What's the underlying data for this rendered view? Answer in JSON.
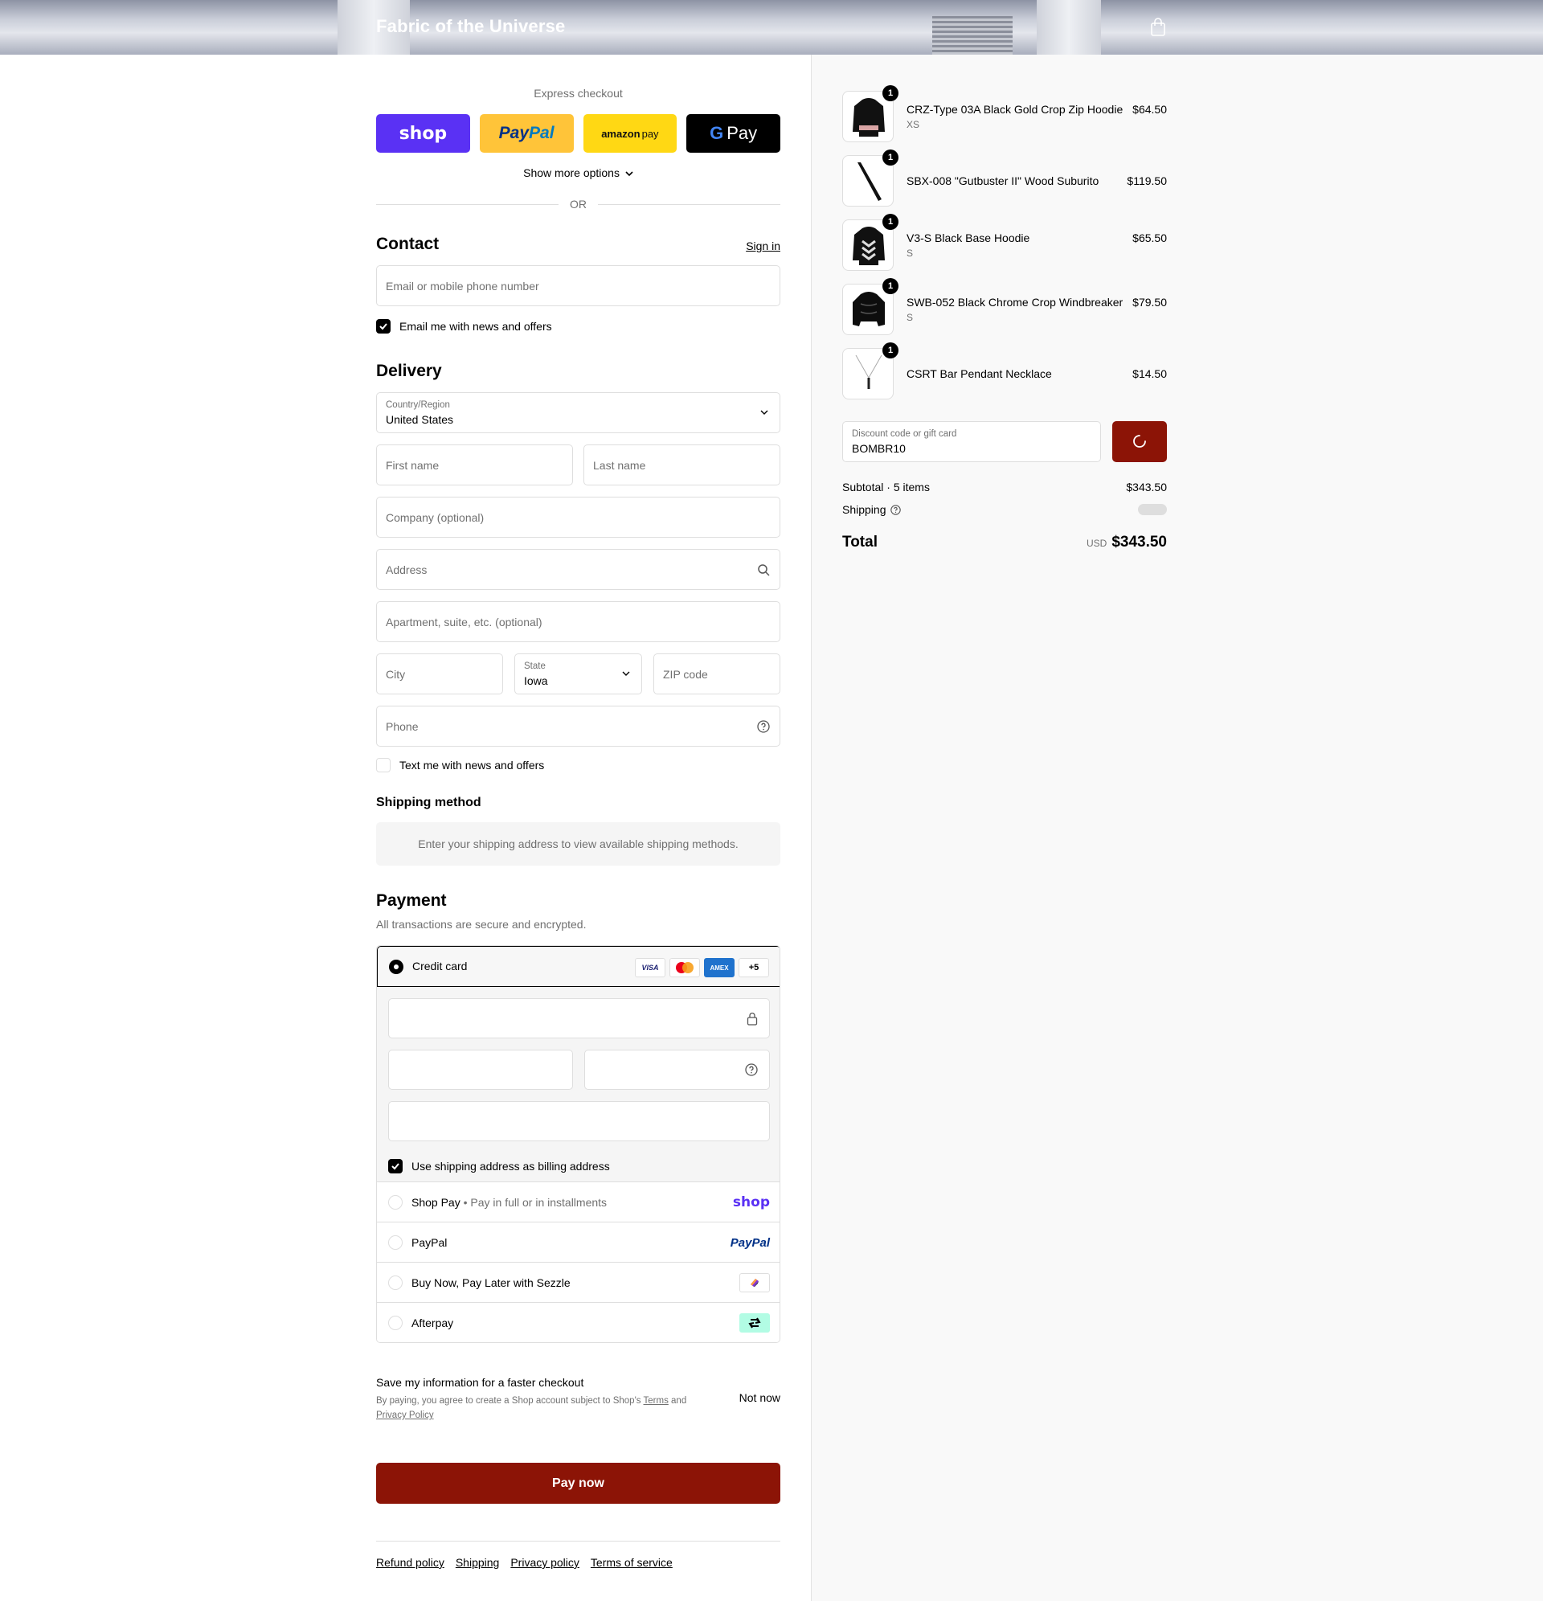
{
  "header": {
    "store_name": "Fabric of the Universe",
    "cart_icon": "shopping-bag-icon"
  },
  "express": {
    "title": "Express checkout",
    "buttons": [
      {
        "name": "shop",
        "label": "shop"
      },
      {
        "name": "paypal",
        "label_a": "Pay",
        "label_b": "Pal"
      },
      {
        "name": "amazon",
        "label_a": "amazon",
        "label_b": "pay"
      },
      {
        "name": "gpay",
        "label_a": "G",
        "label_b": "Pay"
      }
    ],
    "show_more": "Show more options",
    "or": "OR"
  },
  "contact": {
    "title": "Contact",
    "sign_in": "Sign in",
    "email_placeholder": "Email or mobile phone number",
    "newsletter_label": "Email me with news and offers",
    "newsletter_checked": true
  },
  "delivery": {
    "title": "Delivery",
    "country_label": "Country/Region",
    "country_value": "United States",
    "first_name": "First name",
    "last_name": "Last name",
    "company": "Company (optional)",
    "address": "Address",
    "apartment": "Apartment, suite, etc. (optional)",
    "city": "City",
    "state_label": "State",
    "state_value": "Iowa",
    "zip": "ZIP code",
    "phone": "Phone",
    "text_offers_label": "Text me with news and offers",
    "text_offers_checked": false
  },
  "shipping_method": {
    "title": "Shipping method",
    "message": "Enter your shipping address to view available shipping methods."
  },
  "payment": {
    "title": "Payment",
    "subtitle": "All transactions are secure and encrypted.",
    "credit_card_label": "Credit card",
    "card_brands": [
      "VISA",
      "mastercard",
      "AMEX",
      "+5"
    ],
    "billing_label": "Use shipping address as billing address",
    "billing_checked": true,
    "options": [
      {
        "label": "Shop Pay",
        "sub": "Pay in full or in installments",
        "logo": "shop"
      },
      {
        "label": "PayPal",
        "logo": "PayPal"
      },
      {
        "label": "Buy Now, Pay Later with Sezzle",
        "logo": "sezzle-icon"
      },
      {
        "label": "Afterpay",
        "logo": "afterpay-icon"
      }
    ]
  },
  "save_info": {
    "title": "Save my information for a faster checkout",
    "sub_prefix": "By paying, you agree to create a Shop account subject to Shop's ",
    "terms": "Terms",
    "and": " and ",
    "privacy": "Privacy Policy",
    "not_now": "Not now"
  },
  "pay_now": "Pay now",
  "footer": [
    "Refund policy",
    "Shipping",
    "Privacy policy",
    "Terms of service"
  ],
  "summary": {
    "items": [
      {
        "name": "CRZ-Type 03A Black Gold Crop Zip Hoodie",
        "variant": "XS",
        "price": "$64.50",
        "qty": "1"
      },
      {
        "name": "SBX-008 \"Gutbuster II\" Wood Suburito",
        "variant": "",
        "price": "$119.50",
        "qty": "1"
      },
      {
        "name": "V3-S Black Base Hoodie",
        "variant": "S",
        "price": "$65.50",
        "qty": "1"
      },
      {
        "name": "SWB-052 Black Chrome Crop Windbreaker",
        "variant": "S",
        "price": "$79.50",
        "qty": "1"
      },
      {
        "name": "CSRT Bar Pendant Necklace",
        "variant": "",
        "price": "$14.50",
        "qty": "1"
      }
    ],
    "discount_label": "Discount code or gift card",
    "discount_value": "BOMBR10",
    "subtotal_label": "Subtotal · 5 items",
    "subtotal_value": "$343.50",
    "shipping_label": "Shipping",
    "total_label": "Total",
    "currency": "USD",
    "total_value": "$343.50"
  },
  "colors": {
    "accent": "#8c1406",
    "shop_purple": "#5a31f4",
    "paypal_yellow": "#ffc439",
    "amazon_yellow": "#ffd814"
  }
}
